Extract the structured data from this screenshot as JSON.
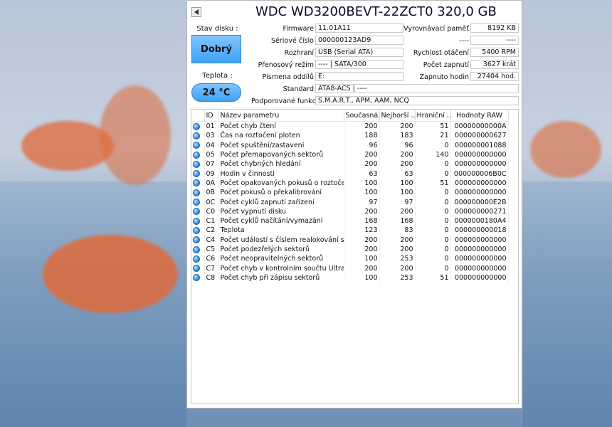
{
  "window": {
    "title": "WDC WD3200BEVT-22ZCT0 320,0 GB"
  },
  "status": {
    "health_label": "Stav disku :",
    "health_value": "Dobrý",
    "temp_label": "Teplota :",
    "temp_value": "24 °C",
    "health_color": "#3fa2f5"
  },
  "fields": {
    "firmware_label": "Firmware",
    "firmware": "11.01A11",
    "serial_label": "Sériové číslo",
    "serial": "000000123AD9",
    "interface_label": "Rozhraní",
    "interface": "USB (Serial ATA)",
    "transfer_label": "Přenosový režim",
    "transfer": "---- | SATA/300",
    "letters_label": "Písmena oddílů",
    "letters": "E:",
    "standard_label": "Standard",
    "standard": "ATA8-ACS | ----",
    "features_label": "Podporované funkce",
    "features": "S.M.A.R.T., APM, AAM, NCQ",
    "buffer_label": "Vyrovnávací paměť",
    "buffer": "8192 KB",
    "blank1_label": "----",
    "blank1": "----",
    "rpm_label": "Rychlost otáčení",
    "rpm": "5400 RPM",
    "power_count_label": "Počet zapnutí",
    "power_count": "3627 krát",
    "power_hours_label": "Zapnuto hodin",
    "power_hours": "27404 hod."
  },
  "smart": {
    "headers": [
      "",
      "ID",
      "Název parametru",
      "Současná...",
      "Nejhorší ...",
      "Hraniční ...",
      "Hodnoty RAW"
    ],
    "rows": [
      [
        "01",
        "Počet chyb čtení",
        "200",
        "200",
        "51",
        "00000000000A"
      ],
      [
        "03",
        "Čas na roztočení ploten",
        "188",
        "183",
        "21",
        "000000000627"
      ],
      [
        "04",
        "Počet spuštění/zastavení",
        "96",
        "96",
        "0",
        "000000001088"
      ],
      [
        "05",
        "Počet přemapovaných sektorů",
        "200",
        "200",
        "140",
        "000000000000"
      ],
      [
        "07",
        "Počet chybných hledání",
        "200",
        "200",
        "0",
        "000000000000"
      ],
      [
        "09",
        "Hodin v činnosti",
        "63",
        "63",
        "0",
        "000000006B0C"
      ],
      [
        "0A",
        "Počet opakovaných pokusů o roztočení plot...",
        "100",
        "100",
        "51",
        "000000000000"
      ],
      [
        "0B",
        "Počet pokusů o překalibrování",
        "100",
        "100",
        "0",
        "000000000000"
      ],
      [
        "0C",
        "Počet cyklů zapnutí zařízení",
        "97",
        "97",
        "0",
        "000000000E2B"
      ],
      [
        "C0",
        "Počet vypnutí disku",
        "200",
        "200",
        "0",
        "000000000271"
      ],
      [
        "C1",
        "Počet cyklů načítání/vymazání",
        "168",
        "168",
        "0",
        "0000000180A4"
      ],
      [
        "C2",
        "Teplota",
        "123",
        "83",
        "0",
        "000000000018"
      ],
      [
        "C4",
        "Počet událostí s číslem realokování sektorů",
        "200",
        "200",
        "0",
        "000000000000"
      ],
      [
        "C5",
        "Počet podezřelých sektorů",
        "200",
        "200",
        "0",
        "000000000000"
      ],
      [
        "C6",
        "Počet neopravitelných sektorů",
        "100",
        "253",
        "0",
        "000000000000"
      ],
      [
        "C7",
        "Počet chyb v kontrolním součtu UltraDMA",
        "200",
        "200",
        "0",
        "000000000000"
      ],
      [
        "C8",
        "Počet chyb při zápisu sektorů",
        "100",
        "253",
        "51",
        "000000000000"
      ]
    ]
  }
}
